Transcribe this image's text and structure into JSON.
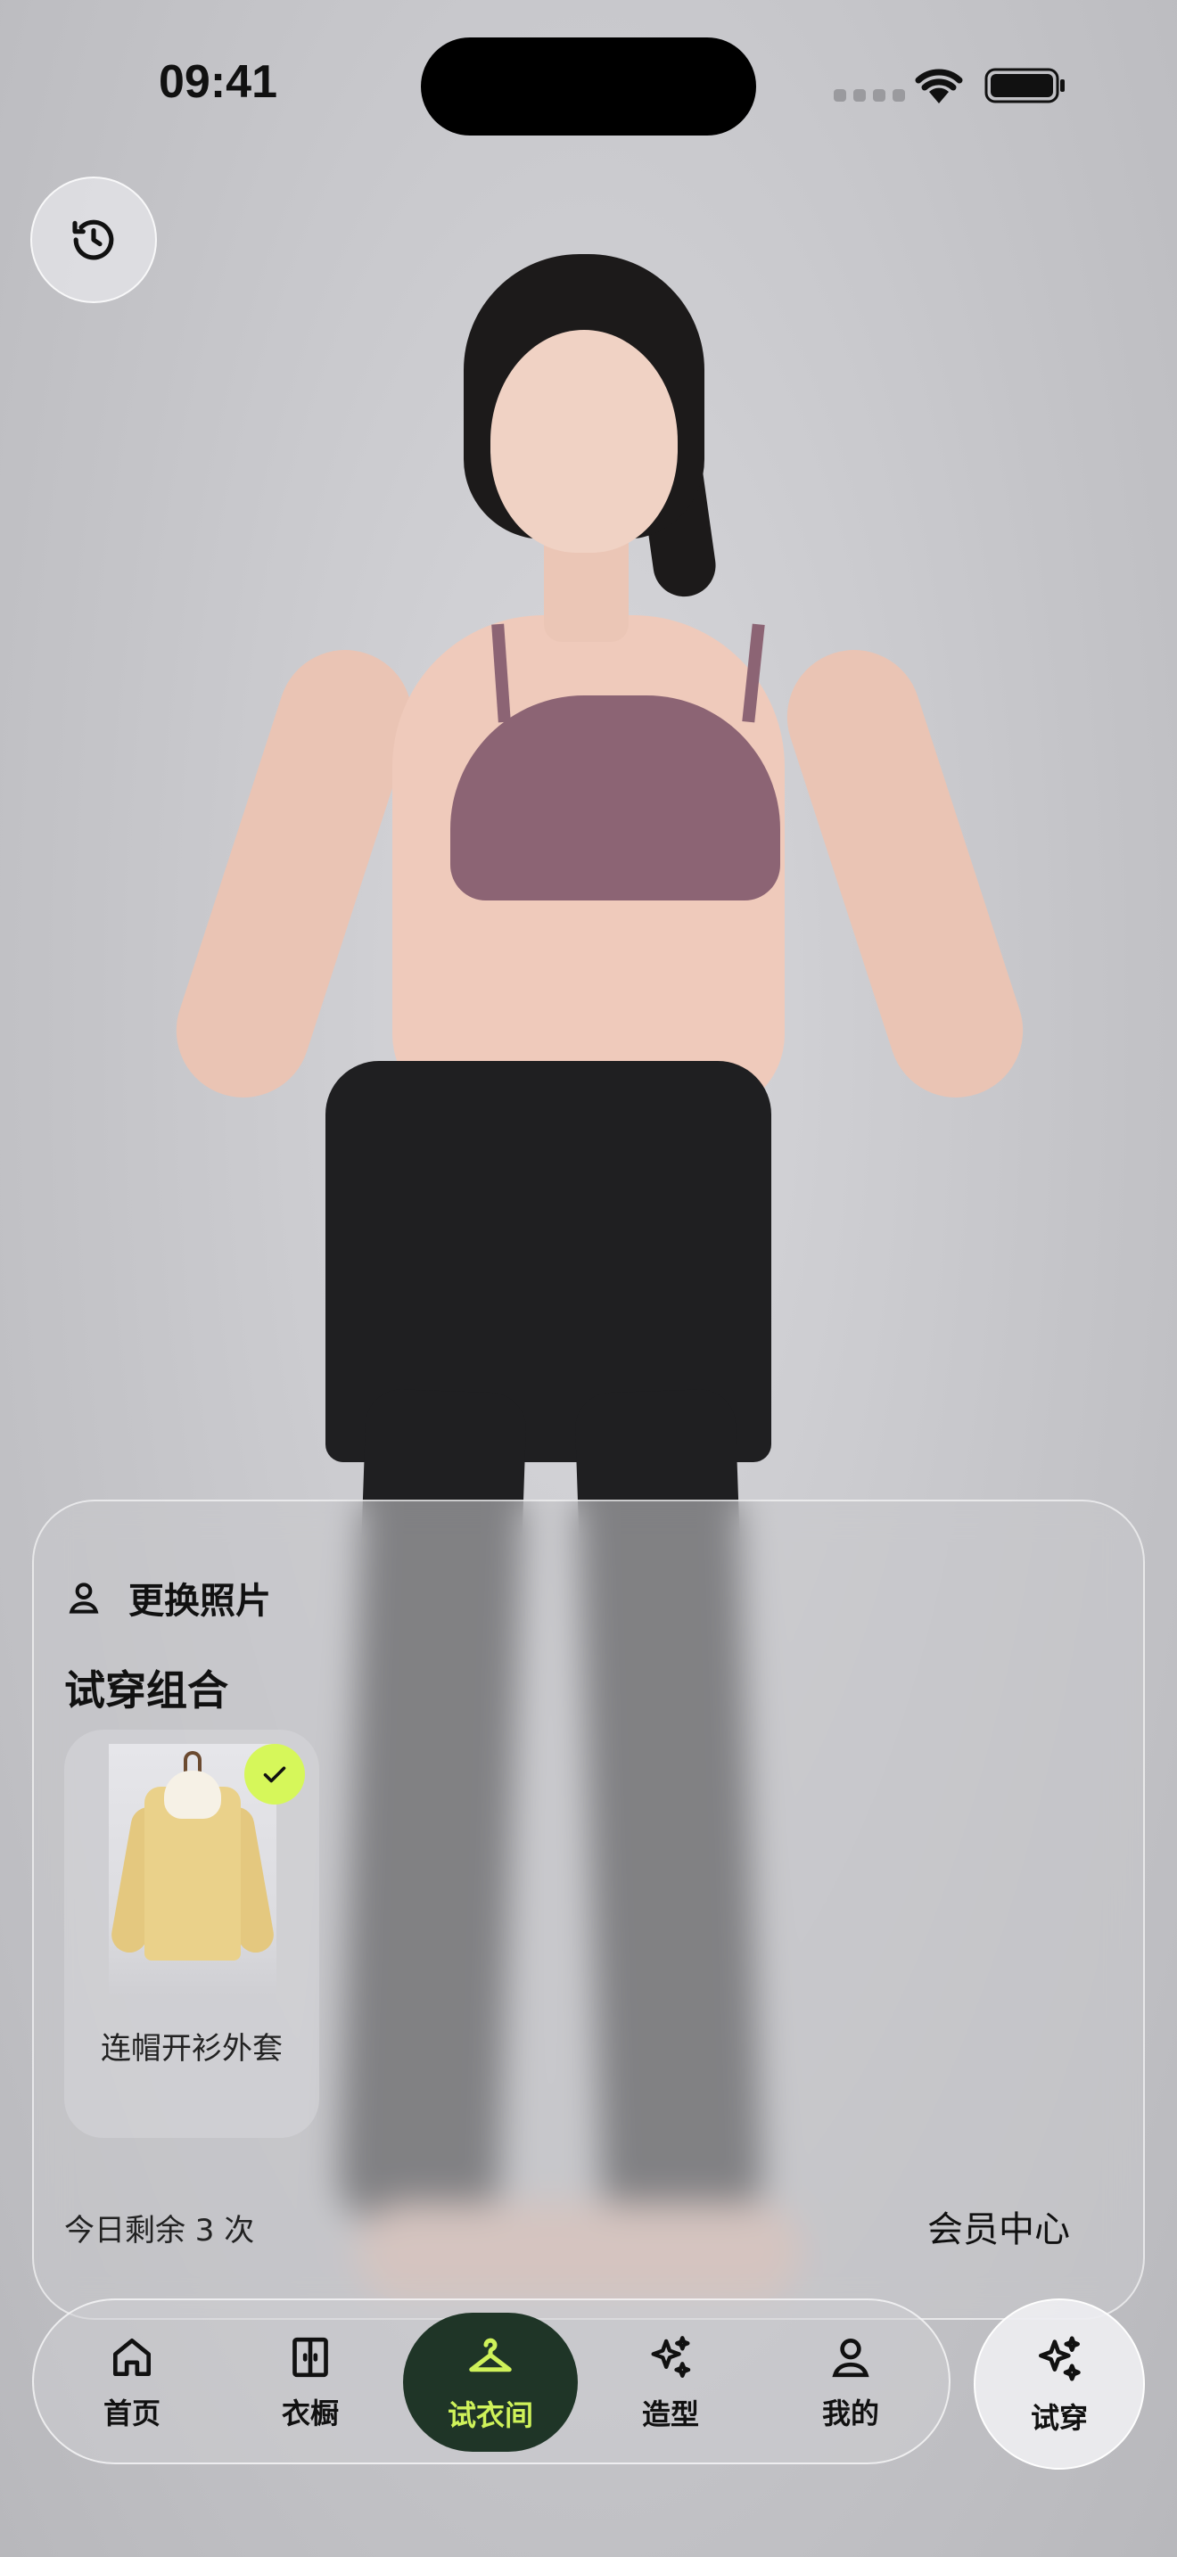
{
  "status_bar": {
    "time": "09:41"
  },
  "panel": {
    "change_photo_label": "更换照片",
    "combo_title": "试穿组合",
    "items": [
      {
        "name": "连帽开衫外套",
        "selected": true
      }
    ],
    "remaining_text": "今日剩余 3 次",
    "member_center_label": "会员中心"
  },
  "tabbar": {
    "tabs": [
      {
        "label": "首页",
        "icon": "home-icon"
      },
      {
        "label": "衣橱",
        "icon": "wardrobe-icon"
      },
      {
        "label": "试衣间",
        "icon": "hanger-icon",
        "active": true
      },
      {
        "label": "造型",
        "icon": "sparkle-icon"
      },
      {
        "label": "我的",
        "icon": "person-icon"
      }
    ],
    "tryon_label": "试穿"
  },
  "colors": {
    "accent_lime": "#d6f75a",
    "active_tab_bg": "#1f3527"
  }
}
